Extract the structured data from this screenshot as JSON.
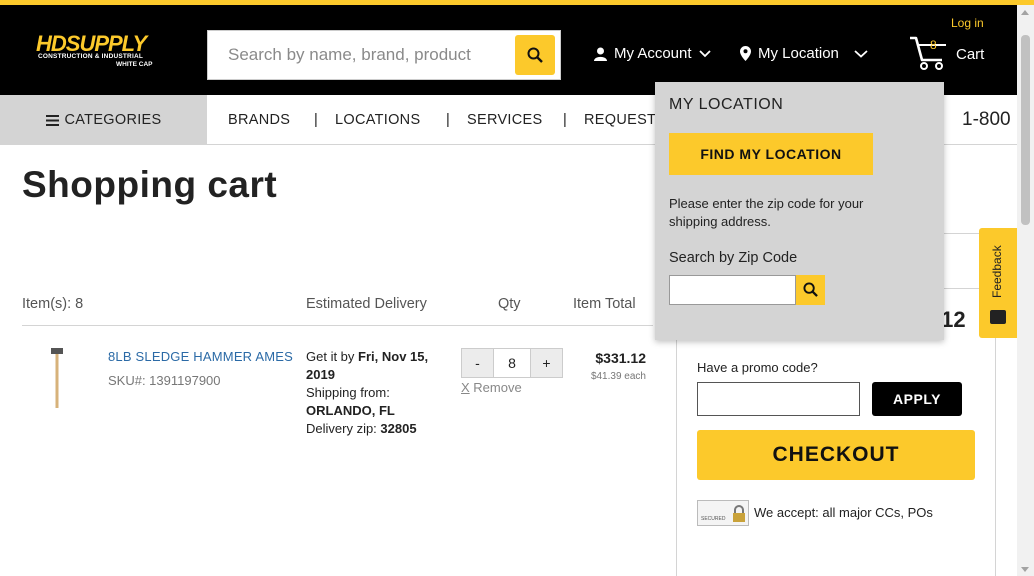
{
  "colors": {
    "accent": "#fcc92b",
    "header_bg": "#000000",
    "nav_gray": "#d4d4d4",
    "link_blue": "#2b6aa6"
  },
  "header": {
    "logo": {
      "main": "HDSUPPLY",
      "sub1": "CONSTRUCTION & INDUSTRIAL",
      "sub2": "WHITE CAP"
    },
    "search": {
      "placeholder": "Search by name, brand, product"
    },
    "my_account": "My Account",
    "my_location": "My Location",
    "login": "Log in",
    "cart": {
      "count": "8",
      "label": "Cart"
    }
  },
  "nav": {
    "categories": "CATEGORIES",
    "items": [
      "BRANDS",
      "LOCATIONS",
      "SERVICES",
      "REQUEST"
    ],
    "separator": "|",
    "phone": "1-800"
  },
  "page": {
    "title": "Shopping cart"
  },
  "cart_table": {
    "headers": {
      "items": "Item(s): 8",
      "delivery": "Estimated Delivery",
      "qty": "Qty",
      "total": "Item Total"
    },
    "rows": [
      {
        "name": "8LB SLEDGE HAMMER AMES",
        "sku": "SKU#: 1391197900",
        "get_it_by_prefix": "Get it by ",
        "get_it_by_date": "Fri, Nov 15, 2019",
        "shipping_from_label": "Shipping from:",
        "shipping_from": "ORLANDO, FL",
        "delivery_zip_label": "Delivery zip: ",
        "delivery_zip": "32805",
        "qty": "8",
        "minus": "-",
        "plus": "+",
        "remove_x": "X",
        "remove": " Remove",
        "total": "$331.12",
        "each": "$41.39 each"
      }
    ]
  },
  "summary": {
    "total_fragment": ".12",
    "promo_label": "Have a promo code?",
    "apply": "APPLY",
    "checkout": "CHECKOUT",
    "accept": "We accept: all major CCs, POs",
    "badge_text": "SECURED"
  },
  "feedback": "Feedback",
  "location_panel": {
    "title": "MY LOCATION",
    "find_button": "FIND MY LOCATION",
    "description": "Please enter the zip code for your shipping address.",
    "zip_label": "Search by Zip Code",
    "zip_value": ""
  }
}
